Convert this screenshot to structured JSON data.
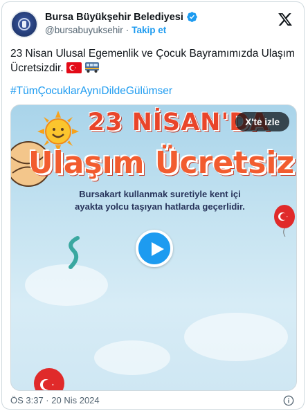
{
  "author": {
    "display_name": "Bursa Büyükşehir Belediyesi",
    "handle": "@bursabuyuksehir",
    "separator": "·",
    "follow_label": "Takip et"
  },
  "tweet": {
    "text": "23 Nisan Ulusal Egemenlik ve Çocuk Bayramımızda Ulaşım Ücretsizdir.",
    "hashtag": "#TümÇocuklarAynıDildeGülümser"
  },
  "media": {
    "watch_label": "X'te izle",
    "headline": "23 NİSAN'DA",
    "subhead": "Ulaşım Ücretsiz",
    "caption_line1": "Bursakart kullanmak suretiyle kent içi",
    "caption_line2": "ayakta yolcu taşıyan hatlarda geçerlidir."
  },
  "footer": {
    "timestamp": "ÖS 3:37 · 20 Nis 2024"
  },
  "colors": {
    "link_blue": "#1d9bf0",
    "text": "#0f1419",
    "muted": "#536471"
  },
  "icons": [
    "verified-badge-icon",
    "x-logo-icon",
    "turkey-flag-icon",
    "bus-icon",
    "play-icon",
    "info-icon"
  ]
}
